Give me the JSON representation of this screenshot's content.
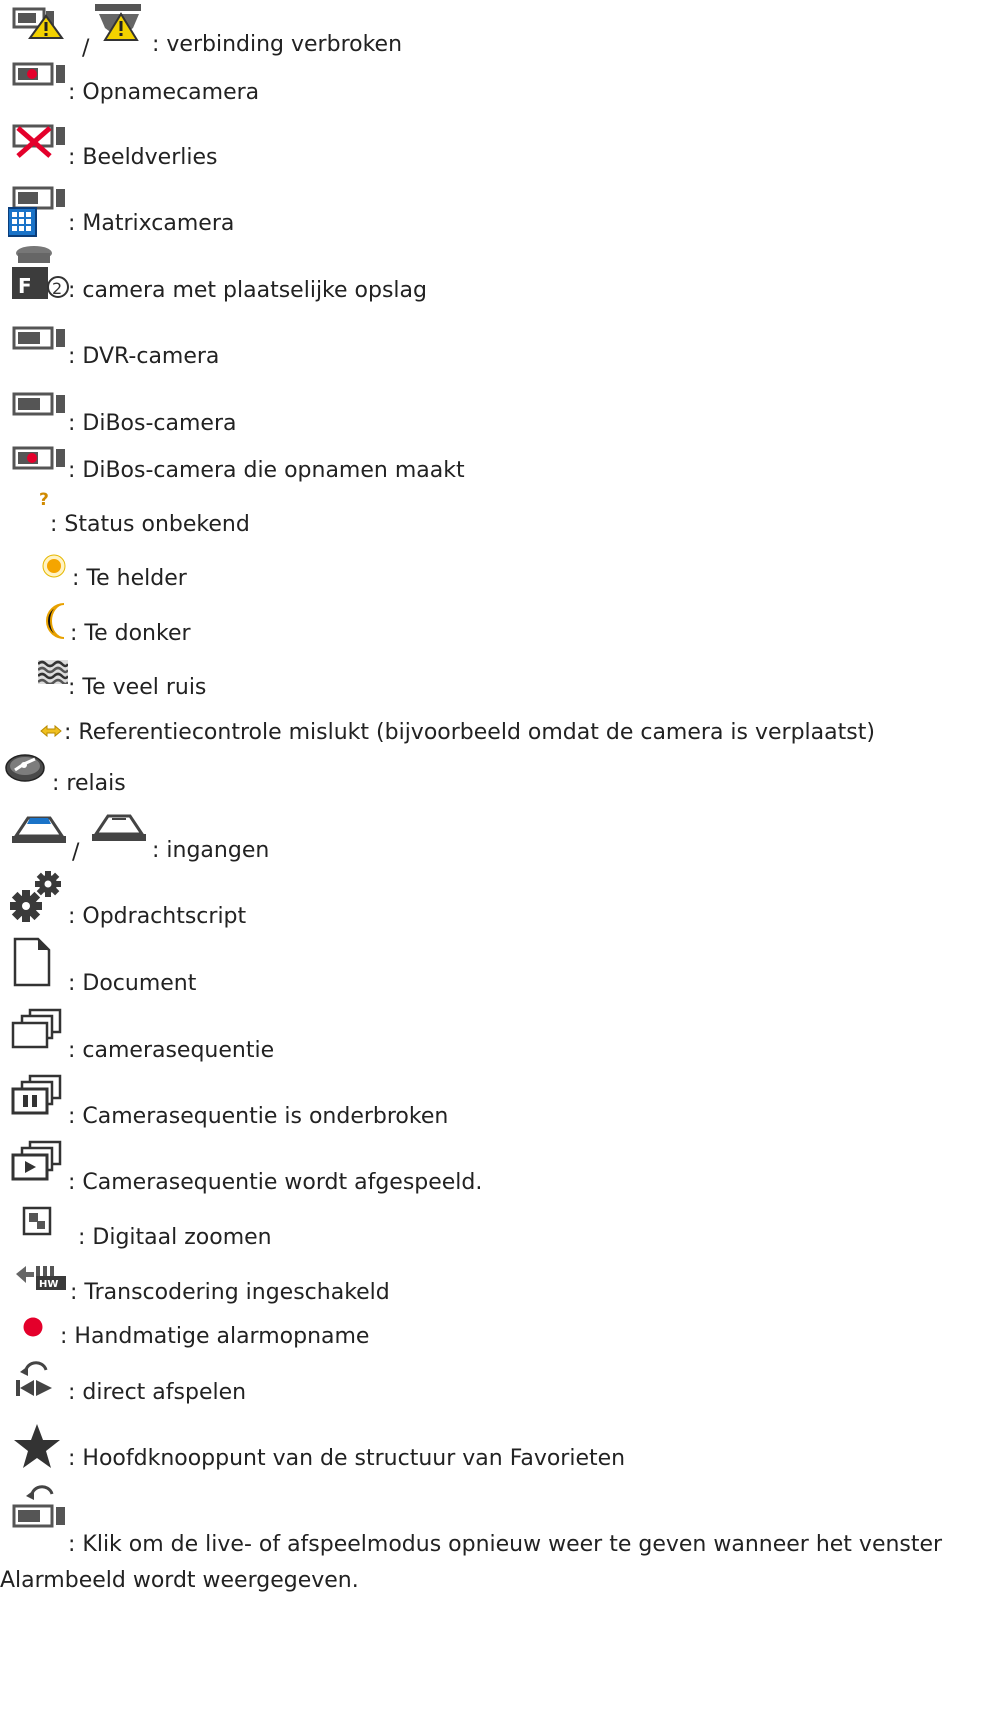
{
  "legend": {
    "items": [
      {
        "icon": "camera-connection-lost-icon",
        "text": ": verbinding verbroken",
        "separator": "/"
      },
      {
        "icon": "recording-camera-icon",
        "text": ": Opnamecamera"
      },
      {
        "icon": "image-loss-icon",
        "text": ": Beeldverlies"
      },
      {
        "icon": "matrix-camera-icon",
        "text": ": Matrixcamera"
      },
      {
        "icon": "local-storage-camera-icon",
        "text": ": camera met plaatselijke opslag"
      },
      {
        "icon": "dvr-camera-icon",
        "text": ": DVR-camera"
      },
      {
        "icon": "dibos-camera-icon",
        "text": ": DiBos-camera"
      },
      {
        "icon": "dibos-recording-camera-icon",
        "text": ": DiBos-camera die opnamen maakt"
      },
      {
        "icon": "status-unknown-icon",
        "text": ": Status onbekend"
      },
      {
        "icon": "too-bright-icon",
        "text": ": Te helder"
      },
      {
        "icon": "too-dark-icon",
        "text": ": Te donker"
      },
      {
        "icon": "too-noisy-icon",
        "text": ": Te veel ruis"
      },
      {
        "icon": "reference-check-failed-icon",
        "text": ": Referentiecontrole mislukt (bijvoorbeeld omdat de camera is verplaatst)"
      },
      {
        "icon": "relay-icon",
        "text": ": relais"
      },
      {
        "icon": "input-icon",
        "text": ": ingangen",
        "separator": "/"
      },
      {
        "icon": "command-script-icon",
        "text": ": Opdrachtscript"
      },
      {
        "icon": "document-icon",
        "text": ": Document"
      },
      {
        "icon": "camera-sequence-icon",
        "text": ": camerasequentie"
      },
      {
        "icon": "camera-sequence-paused-icon",
        "text": ": Camerasequentie is onderbroken"
      },
      {
        "icon": "camera-sequence-playing-icon",
        "text": ": Camerasequentie wordt afgespeeld."
      },
      {
        "icon": "digital-zoom-icon",
        "text": ": Digitaal zoomen"
      },
      {
        "icon": "transcoding-icon",
        "text": ": Transcodering ingeschakeld"
      },
      {
        "icon": "manual-alarm-recording-icon",
        "text": ": Handmatige alarmopname"
      },
      {
        "icon": "instant-playback-icon",
        "text": ": direct afspelen"
      },
      {
        "icon": "favorites-root-icon",
        "text": ": Hoofdknooppunt van de structuur van Favorieten"
      },
      {
        "icon": "restore-live-playback-icon",
        "text": ": Klik om de live- of afspeelmodus opnieuw weer te geven wanneer het venster",
        "continuation": "Alarmbeeld wordt weergegeven."
      }
    ]
  }
}
